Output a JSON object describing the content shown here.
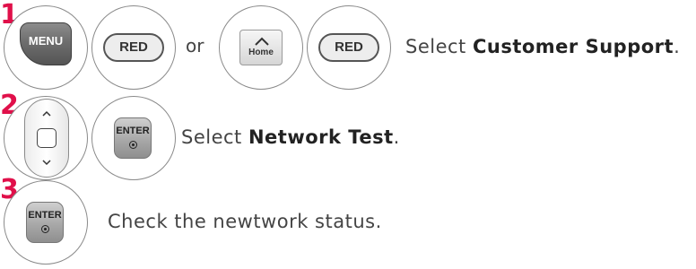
{
  "steps": [
    {
      "number": "1",
      "keys": [
        "MENU",
        "RED",
        "Home",
        "RED"
      ],
      "separator": "or",
      "text_prefix": "Select ",
      "text_bold": "Customer Support",
      "text_suffix": "."
    },
    {
      "number": "2",
      "keys": [
        "ENTER"
      ],
      "text_prefix": "Select ",
      "text_bold": "Network Test",
      "text_suffix": "."
    },
    {
      "number": "3",
      "keys": [
        "ENTER"
      ],
      "text": "Check the newtwork status."
    }
  ],
  "colors": {
    "step_number": "#e0104a",
    "key_dark": "#6e6e6e",
    "text": "#444444"
  }
}
